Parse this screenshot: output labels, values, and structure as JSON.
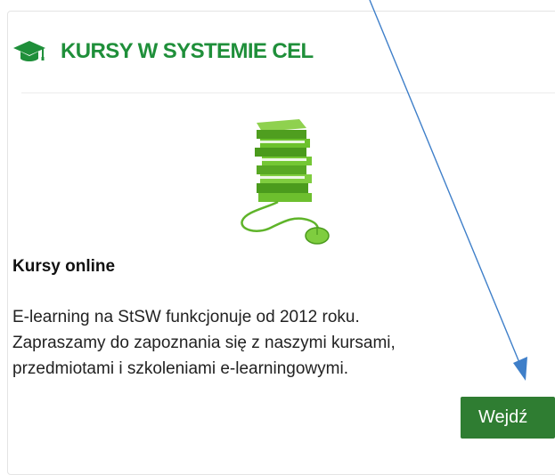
{
  "card": {
    "title": "KURSY W SYSTEMIE CEL",
    "header_icon": "graduation-cap-icon",
    "illustration_icon": "books-and-mouse-icon",
    "subtitle": "Kursy online",
    "description_lines": [
      "E-learning na StSW funkcjonuje od 2012 roku.",
      "Zapraszamy do zapoznania się z naszymi kursami,",
      "przedmiotami i szkoleniami e-learningowymi."
    ],
    "button_label": "Wejdź"
  },
  "colors": {
    "accent_green": "#1f8f3a",
    "button_green": "#2f7d32",
    "annotation_arrow": "#3f7fc9"
  }
}
